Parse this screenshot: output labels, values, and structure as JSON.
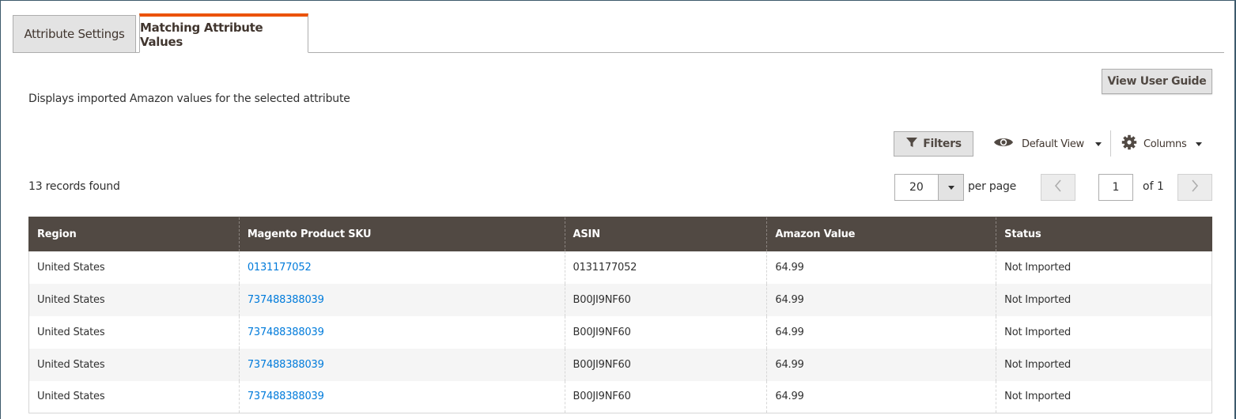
{
  "tabs": [
    {
      "label": "Attribute Settings",
      "active": false
    },
    {
      "label": "Matching Attribute Values",
      "active": true
    }
  ],
  "description": "Displays imported Amazon values for the selected attribute",
  "actions": {
    "view_user_guide": "View User Guide"
  },
  "toolbar": {
    "filters_label": "Filters",
    "view_label": "Default View",
    "columns_label": "Columns"
  },
  "records_found": "13 records found",
  "pagination": {
    "per_page_value": "20",
    "per_page_label": "per page",
    "current_page": "1",
    "of_label": "of 1"
  },
  "table": {
    "columns": [
      "Region",
      "Magento Product SKU",
      "ASIN",
      "Amazon Value",
      "Status"
    ],
    "rows": [
      [
        "United States",
        "0131177052",
        "0131177052",
        "64.99",
        "Not Imported"
      ],
      [
        "United States",
        "737488388039",
        "B00JI9NF60",
        "64.99",
        "Not Imported"
      ],
      [
        "United States",
        "737488388039",
        "B00JI9NF60",
        "64.99",
        "Not Imported"
      ],
      [
        "United States",
        "737488388039",
        "B00JI9NF60",
        "64.99",
        "Not Imported"
      ],
      [
        "United States",
        "737488388039",
        "B00JI9NF60",
        "64.99",
        "Not Imported"
      ]
    ]
  },
  "colors": {
    "accent_tab": "#eb5202",
    "header_bg": "#514943",
    "link": "#007bdb"
  },
  "icons": {
    "filters": "funnel-icon",
    "view": "eye-icon",
    "columns": "gear-icon",
    "prev": "chevron-left-icon",
    "next": "chevron-right-icon"
  }
}
